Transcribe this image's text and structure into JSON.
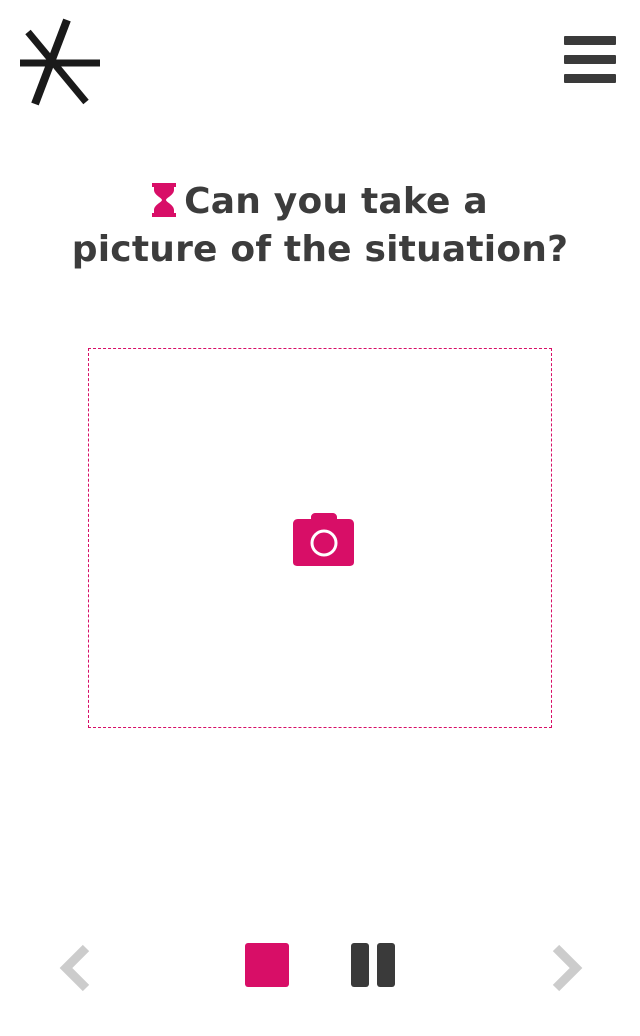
{
  "header": {
    "logo_icon": "asterisk-logo-icon",
    "menu_icon": "hamburger-menu-icon"
  },
  "question": {
    "line1": "Can you take a",
    "line2": "picture of the situation?",
    "icon": "hourglass-icon"
  },
  "upload": {
    "icon": "camera-icon"
  },
  "controls": {
    "prev_icon": "chevron-left-icon",
    "stop_icon": "stop-icon",
    "pause_icon": "pause-icon",
    "next_icon": "chevron-right-icon"
  },
  "colors": {
    "accent": "#d80e67",
    "text": "#3c3c3c",
    "dark": "#3a3a3a",
    "disabled": "#cccccc"
  }
}
